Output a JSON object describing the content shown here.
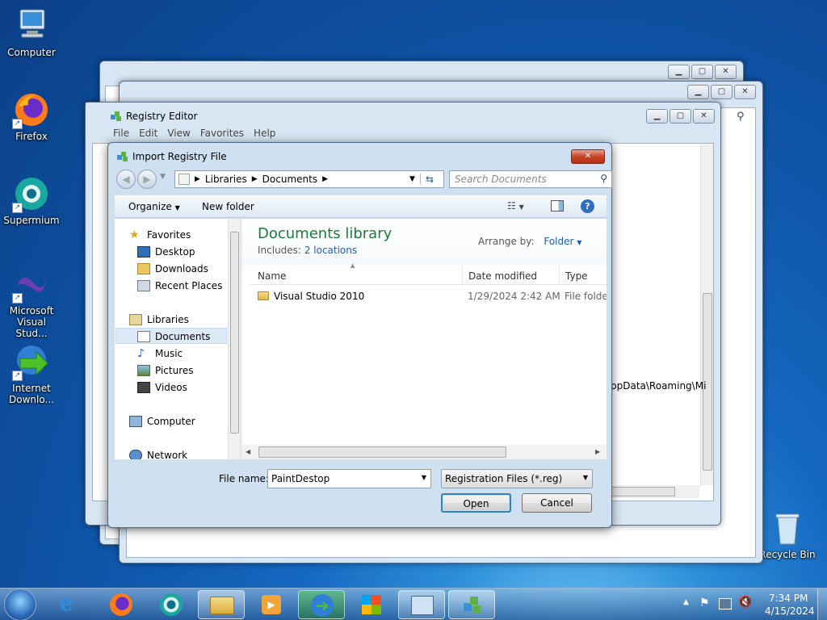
{
  "desktop_icons": [
    {
      "label": "Computer"
    },
    {
      "label": "Firefox"
    },
    {
      "label": "Supermium"
    },
    {
      "label": "Microsoft Visual Stud..."
    },
    {
      "label": "Internet Downlo..."
    },
    {
      "label": "Recycle Bin"
    }
  ],
  "registry_editor": {
    "title": "Registry Editor",
    "menu": [
      "File",
      "Edit",
      "View",
      "Favorites",
      "Help"
    ],
    "path_fragment": "ppData\\Roaming\\Mi"
  },
  "dialog": {
    "title": "Import Registry File",
    "breadcrumb": [
      "Libraries",
      "Documents"
    ],
    "search_placeholder": "Search Documents",
    "organize": "Organize",
    "new_folder": "New folder",
    "nav": {
      "favorites": "Favorites",
      "desktop": "Desktop",
      "downloads": "Downloads",
      "recent": "Recent Places",
      "libraries": "Libraries",
      "documents": "Documents",
      "music": "Music",
      "pictures": "Pictures",
      "videos": "Videos",
      "computer": "Computer",
      "network": "Network"
    },
    "library_title": "Documents library",
    "includes_label": "Includes:",
    "includes_link": "2 locations",
    "arrange_label": "Arrange by:",
    "arrange_value": "Folder",
    "columns": [
      "Name",
      "Date modified",
      "Type"
    ],
    "rows": [
      {
        "name": "Visual Studio 2010",
        "date": "1/29/2024 2:42 AM",
        "type": "File folder"
      }
    ],
    "filename_label": "File name:",
    "filename_value": "PaintDestop",
    "filetype_value": "Registration Files (*.reg)",
    "open": "Open",
    "cancel": "Cancel"
  },
  "clock": {
    "time": "7:34 PM",
    "date": "4/15/2024"
  },
  "colors": {
    "accent_green": "#1e7a3c",
    "link": "#1a5fb4",
    "selection": "#dce9f7"
  }
}
